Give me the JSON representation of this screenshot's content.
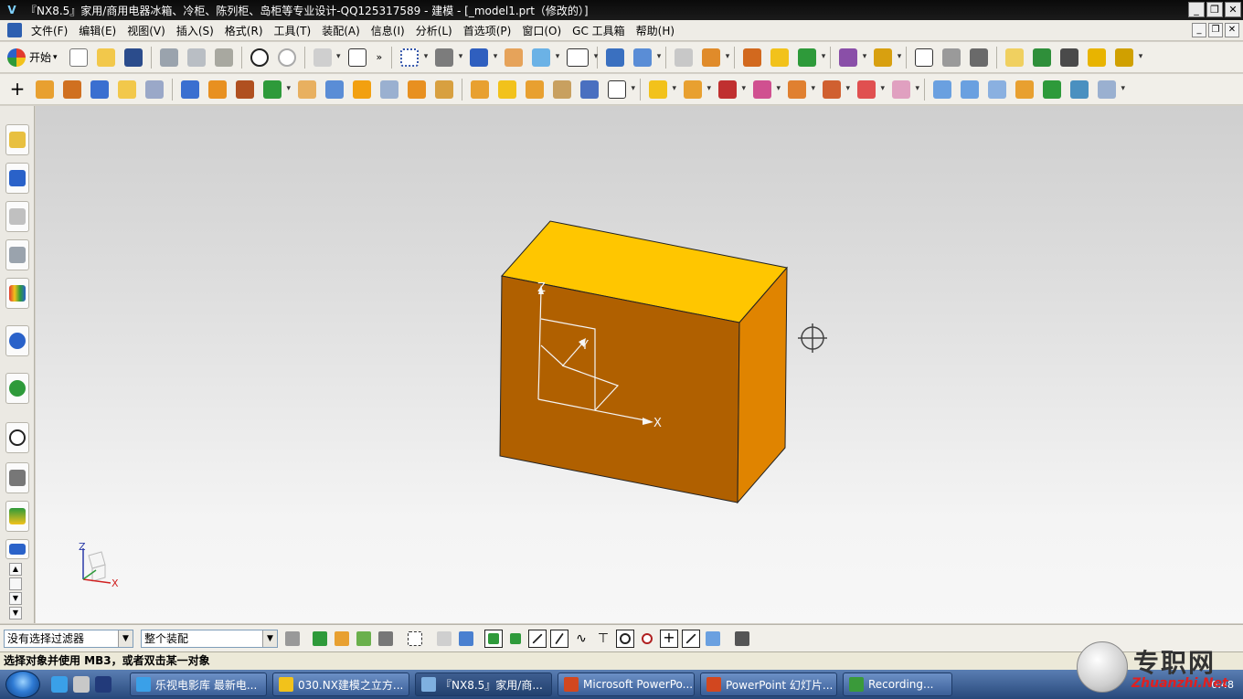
{
  "window": {
    "title": "『NX8.5』家用/商用电器冰箱、冷柜、陈列柜、岛柜等专业设计-QQ125317589 - 建模 - [_model1.prt（修改的）]",
    "controls": [
      "_",
      "❐",
      "✕"
    ]
  },
  "menubar": {
    "items": [
      "文件(F)",
      "编辑(E)",
      "视图(V)",
      "插入(S)",
      "格式(R)",
      "工具(T)",
      "装配(A)",
      "信息(I)",
      "分析(L)",
      "首选项(P)",
      "窗口(O)",
      "GC 工具箱",
      "帮助(H)"
    ],
    "doc_controls": [
      "_",
      "❐",
      "✕"
    ]
  },
  "toolbar1": {
    "start_label": "开始",
    "overflow": "»"
  },
  "model": {
    "top_color": "#ffc600",
    "front_color": "#b06000",
    "side_color": "#e08400",
    "wcs_labels": {
      "x": "X",
      "y": "Y",
      "z": "Z"
    }
  },
  "triad": {
    "x": "X",
    "y": "Y",
    "z": "Z"
  },
  "selection_bar": {
    "filter_value": "没有选择过滤器",
    "scope_value": "整个装配"
  },
  "status": {
    "prompt": "选择对象并使用 MB3，或者双击某一对象"
  },
  "taskbar": {
    "buttons": [
      {
        "label": "乐视电影库 最新电...",
        "icon_color": "#3aa0e8"
      },
      {
        "label": "030.NX建模之立方...",
        "icon_color": "#f2c21b"
      },
      {
        "label": "『NX8.5』家用/商...",
        "icon_color": "#7fb0e0",
        "active": true
      },
      {
        "label": "Microsoft PowerPo...",
        "icon_color": "#d2471f"
      },
      {
        "label": "PowerPoint 幻灯片...",
        "icon_color": "#d2471f"
      },
      {
        "label": "Recording...",
        "icon_color": "#3a9a3a"
      }
    ],
    "clock": "0:48"
  },
  "watermark": {
    "title": "专职网",
    "subtitle": "Zhuanzhi.Net"
  }
}
